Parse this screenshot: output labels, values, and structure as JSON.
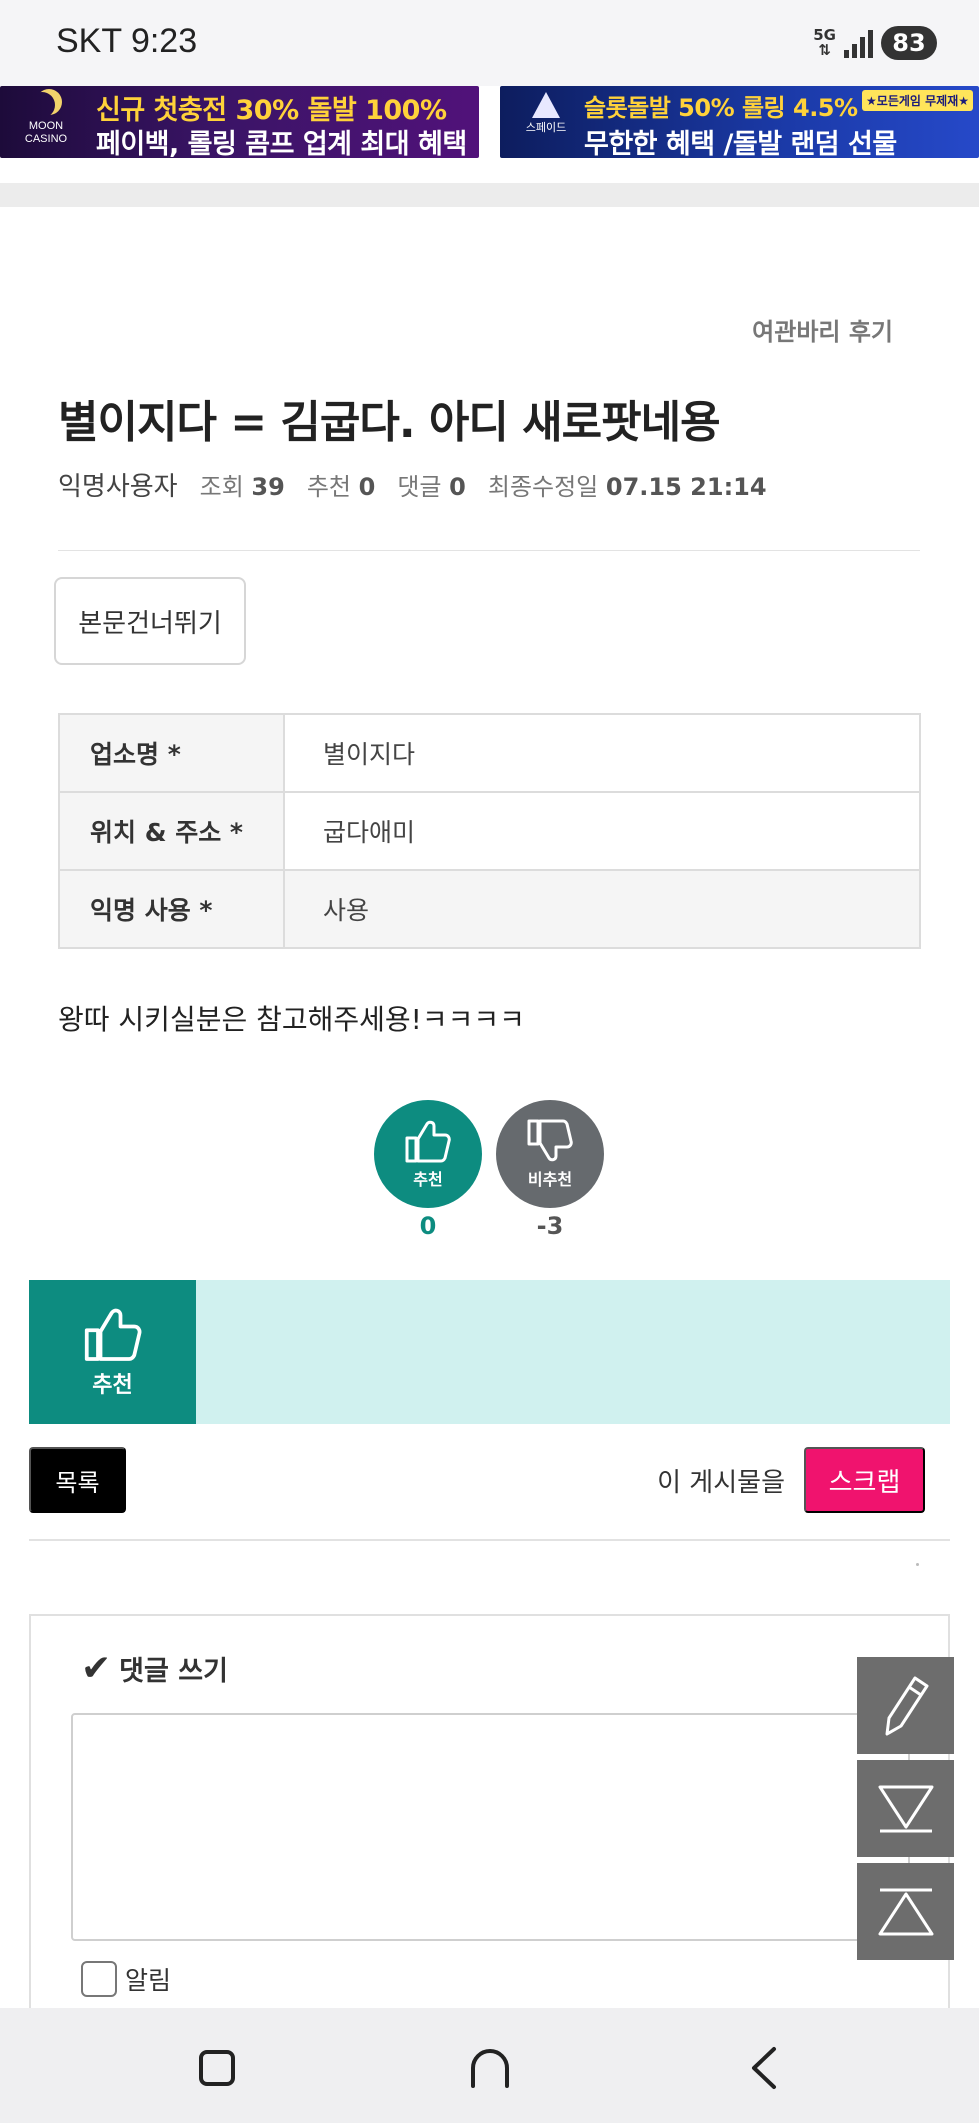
{
  "status_bar": {
    "carrier_time": "SKT 9:23",
    "network": "5G",
    "battery": "83"
  },
  "banners": [
    {
      "logo_top": "MOON",
      "logo_bottom": "CASINO",
      "line1": "신규 첫충전 30% 돌발 100%",
      "line2": "페이백, 롤링 콤프 업계 최대 혜택"
    },
    {
      "logo": "스페이드",
      "line1": "슬롯돌발 50% 롤링 4.5%",
      "badge": "★모든게임 무제재★",
      "line2": "무한한 혜택 /돌발 랜덤 선물"
    }
  ],
  "post": {
    "category": "여관바리 후기",
    "title": "별이지다 = 김굽다. 아디 새로팟네용",
    "author": "익명사용자",
    "views_label": "조회",
    "views": "39",
    "recommend_label": "추천",
    "recommend": "0",
    "comments_label": "댓글",
    "comments": "0",
    "modified_label": "최종수정일",
    "modified": "07.15 21:14",
    "skip_button": "본문건너뛰기",
    "info": [
      {
        "key": "업소명 *",
        "value": "별이지다"
      },
      {
        "key": "위치 & 주소 *",
        "value": "굽다애미"
      },
      {
        "key": "익명 사용 *",
        "value": "사용"
      }
    ],
    "body": "왕따 시키실분은 참고해주세용!ㅋㅋㅋㅋ"
  },
  "votes": {
    "up_label": "추천",
    "up_count": "0",
    "down_label": "비추천",
    "down_count": "-3"
  },
  "recommend_bar": {
    "label": "추천"
  },
  "actions": {
    "list_button": "목록",
    "scrap_prompt": "이 게시물을",
    "scrap_button": "스크랩"
  },
  "comment": {
    "title": "댓글 쓰기",
    "notify_label": "알림"
  },
  "colors": {
    "accent_teal": "#0d8c80",
    "light_teal": "#d0f1ef",
    "scrap_pink": "#f0136e",
    "fab_gray": "#6d6d6d"
  },
  "icons": [
    "thumbs-up-icon",
    "thumbs-down-icon",
    "pencil-icon",
    "scroll-down-icon",
    "scroll-up-icon",
    "recent-apps-icon",
    "home-icon",
    "back-icon"
  ]
}
